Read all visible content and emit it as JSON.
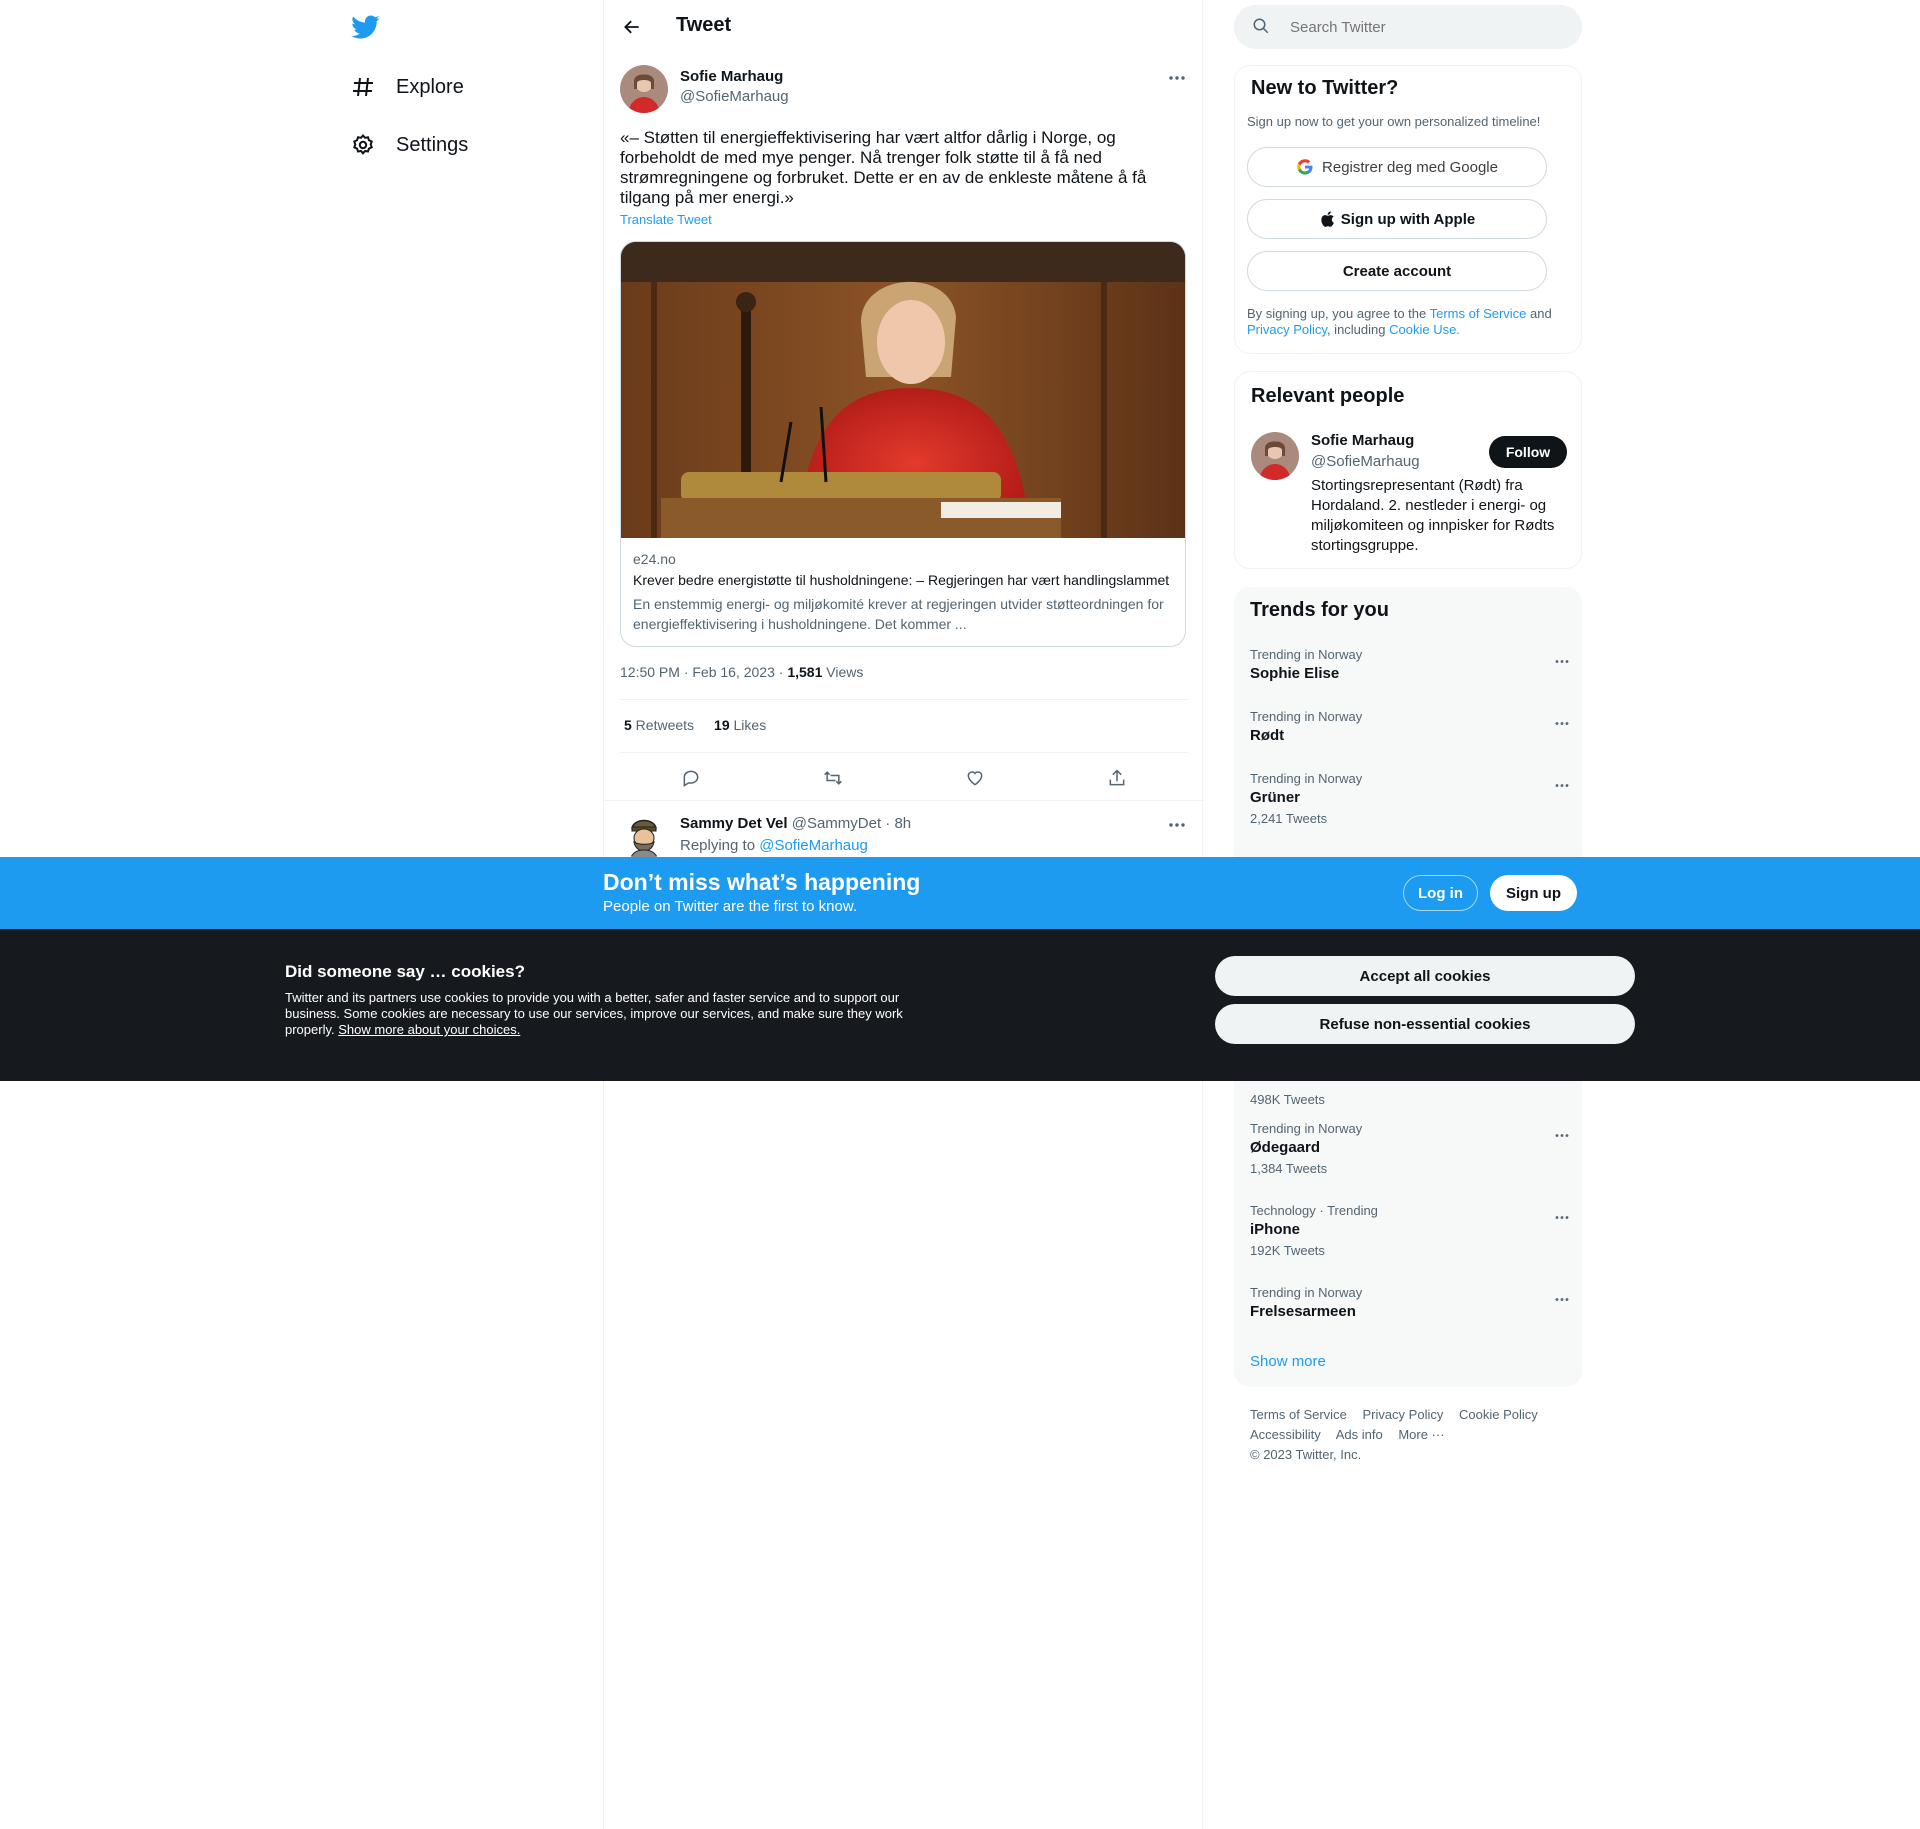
{
  "nav": {
    "items": [
      {
        "label": "Explore",
        "icon": "hashtag-icon"
      },
      {
        "label": "Settings",
        "icon": "gear-icon"
      }
    ]
  },
  "header": {
    "title": "Tweet"
  },
  "tweet": {
    "author_name": "Sofie Marhaug",
    "author_handle": "@SofieMarhaug",
    "text": "«– Støtten til energieffektivisering har vært altfor dårlig i Norge, og forbeholdt de med mye penger. Nå trenger folk støtte til å få ned strømregningene og forbruket. Dette er en av de enkleste måtene å få tilgang på mer energi.»",
    "translate": "Translate Tweet",
    "card": {
      "domain": "e24.no",
      "title": "Krever bedre energistøtte til husholdningene: – Regjeringen har vært handlingslammet",
      "description": "En enstemmig energi- og miljøkomité krever at regjeringen utvider støtteordningen for energieffektivisering i husholdningene. Det kommer ..."
    },
    "time": "12:50 PM · Feb 16, 2023 · ",
    "views_count": "1,581",
    "views_label": " Views",
    "retweets_count": "5",
    "retweets_label": " Retweets",
    "likes_count": "19",
    "likes_label": " Likes"
  },
  "reply": {
    "name": "Sammy Det Vel",
    "handle_time": " @SammyDet · 8h",
    "replying_prefix": "Replying to ",
    "replying_to": "@SofieMarhaug"
  },
  "search": {
    "placeholder": "Search Twitter"
  },
  "signup": {
    "title": "New to Twitter?",
    "subtitle": "Sign up now to get your own personalized timeline!",
    "google": "Registrer deg med Google",
    "apple": "Sign up with Apple",
    "create": "Create account",
    "legal_1": "By signing up, you agree to the ",
    "terms": "Terms of Service",
    "legal_2": " and ",
    "privacy": "Privacy Policy",
    "legal_3": ", including ",
    "cookie_use": "Cookie Use."
  },
  "relevant": {
    "title": "Relevant people",
    "name": "Sofie Marhaug",
    "handle": "@SofieMarhaug",
    "follow": "Follow",
    "bio": "Stortingsrepresentant (Rødt) fra Hordaland. 2. nestleder i energi- og miljøkomiteen og innpisker for Rødts stortingsgruppe."
  },
  "trends": {
    "title": "Trends for you",
    "show_more": "Show more",
    "visible_count_text": "498K Tweets",
    "items": [
      {
        "context": "Trending in Norway",
        "name": "Sophie Elise",
        "count": ""
      },
      {
        "context": "Trending in Norway",
        "name": "Rødt",
        "count": ""
      },
      {
        "context": "Trending in Norway",
        "name": "Grüner",
        "count": "2,241 Tweets"
      },
      {
        "context": "Trending in Norway",
        "name": "Ødegaard",
        "count": "1,384 Tweets"
      },
      {
        "context": "Technology · Trending",
        "name": "iPhone",
        "count": "192K Tweets"
      },
      {
        "context": "Trending in Norway",
        "name": "Frelsesarmeen",
        "count": ""
      }
    ]
  },
  "footer": {
    "links": [
      "Terms of Service",
      "Privacy Policy",
      "Cookie Policy",
      "Accessibility",
      "Ads info",
      "More ···"
    ],
    "copyright": "© 2023 Twitter, Inc."
  },
  "banner": {
    "title": "Don’t miss what’s happening",
    "subtitle": "People on Twitter are the first to know.",
    "login": "Log in",
    "signup": "Sign up"
  },
  "cookies": {
    "title": "Did someone say … cookies?",
    "text": "Twitter and its partners use cookies to provide you with a better, safer and faster service and to support our business. Some cookies are necessary to use our services, improve our services, and make sure they work properly. ",
    "link": "Show more about your choices.",
    "accept": "Accept all cookies",
    "refuse": "Refuse non-essential cookies"
  },
  "colors": {
    "accent": "#1d9bf0",
    "text": "#0f1419",
    "muted": "#536471",
    "cookie_bg": "#16191e"
  }
}
